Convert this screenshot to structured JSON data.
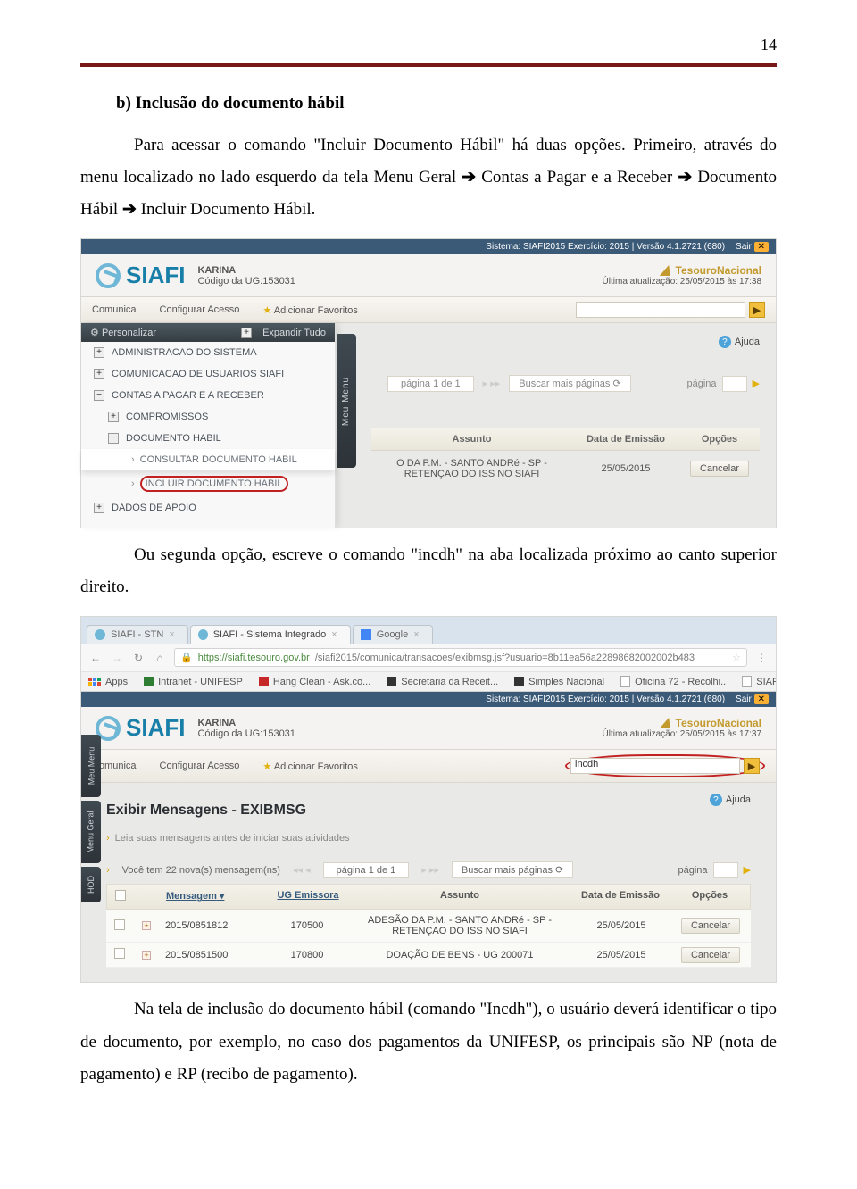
{
  "page_number": "14",
  "heading": "b) Inclusão do documento hábil",
  "para1_pre": "Para acessar o comando \"Incluir Documento Hábil\" há duas opções. Primeiro, através do menu localizado no lado esquerdo da tela Menu Geral ",
  "arrow": "➔",
  "para1_b": " Contas a Pagar e a Receber ",
  "para1_c": " Documento Hábil ",
  "para1_d": " Incluir Documento Hábil.",
  "para2_pre": "Ou segunda opção, escreve o comando \"incdh\" na aba localizada próximo ao canto superior direito.",
  "para3": "Na tela de inclusão do documento hábil (comando \"Incdh\"), o usuário deverá identificar o tipo de documento, por exemplo, no caso dos pagamentos da UNIFESP, os principais são NP (nota de pagamento) e RP (recibo de pagamento).",
  "siafi": {
    "sysinfo": "Sistema: SIAFI2015 Exercício: 2015 | Versão 4.1.2721 (680)",
    "sair": "Sair",
    "logo": "SIAFI",
    "user": "KARINA",
    "ug": "Código da UG:153031",
    "tesouro": "TesouroNacional",
    "ultima1": "Última atualização: 25/05/2015 às 17:38",
    "ultima2": "Última atualização: 25/05/2015 às 17:37",
    "menu_comunica": "Comunica",
    "menu_config": "Configurar Acesso",
    "menu_fav": "Adicionar Favoritos",
    "ajuda": "Ajuda"
  },
  "sidebar": {
    "personalizar": "Personalizar",
    "expandir": "Expandir Tudo",
    "items": [
      "ADMINISTRACAO DO SISTEMA",
      "COMUNICACAO DE USUARIOS SIAFI",
      "CONTAS A PAGAR E A RECEBER",
      "COMPROMISSOS",
      "DOCUMENTO HABIL",
      "CONSULTAR DOCUMENTO HABIL",
      "INCLUIR DOCUMENTO HABIL",
      "DADOS DE APOIO"
    ],
    "meu_menu": "Meu Menu"
  },
  "pager": {
    "page": "página 1 de 1",
    "buscar": "Buscar mais páginas",
    "pagina": "página"
  },
  "table1": {
    "col_assunto": "Assunto",
    "col_data": "Data de Emissão",
    "col_opcoes": "Opções",
    "assunto_val": "O DA P.M. - SANTO ANDRé - SP - RETENÇAO DO ISS NO SIAFI",
    "data_val": "25/05/2015",
    "cancelar": "Cancelar"
  },
  "browser": {
    "tab1": "SIAFI - STN",
    "tab2": "SIAFI - Sistema Integrado",
    "tab3": "Google",
    "url_host": "https://siafi.tesouro.gov.br",
    "url_rest": "/siafi2015/comunica/transacoes/exibmsg.jsf?usuario=8b11ea56a22898682002002b483",
    "apps": "Apps",
    "bm1": "Intranet - UNIFESP",
    "bm2": "Hang Clean - Ask.co...",
    "bm3": "Secretaria da Receit...",
    "bm4": "Simples Nacional",
    "bm5": "Oficina 72 - Recolhi..",
    "bm6": "SIAFI Gerencial - We.."
  },
  "cmd_input": "incdh",
  "exibmsg": {
    "title": "Exibir Mensagens - EXIBMSG",
    "leia": "Leia suas mensagens antes de iniciar suas atividades",
    "voce": "Você tem 22 nova(s) mensagem(ns)",
    "col_msg": "Mensagem",
    "col_ug": "UG Emissora",
    "col_assunto": "Assunto",
    "col_data": "Data de Emissão",
    "col_op": "Opções",
    "rows": [
      {
        "msg": "2015/0851812",
        "ug": "170500",
        "assunto": "ADESÃO DA P.M. - SANTO ANDRé - SP - RETENÇAO DO ISS NO SIAFI",
        "data": "25/05/2015"
      },
      {
        "msg": "2015/0851500",
        "ug": "170800",
        "assunto": "DOAÇÃO DE BENS - UG 200071",
        "data": "25/05/2015"
      }
    ],
    "cancelar": "Cancelar"
  },
  "side2": {
    "t1": "Meu Menu",
    "t2": "Menu Geral",
    "t3": "HOD"
  }
}
